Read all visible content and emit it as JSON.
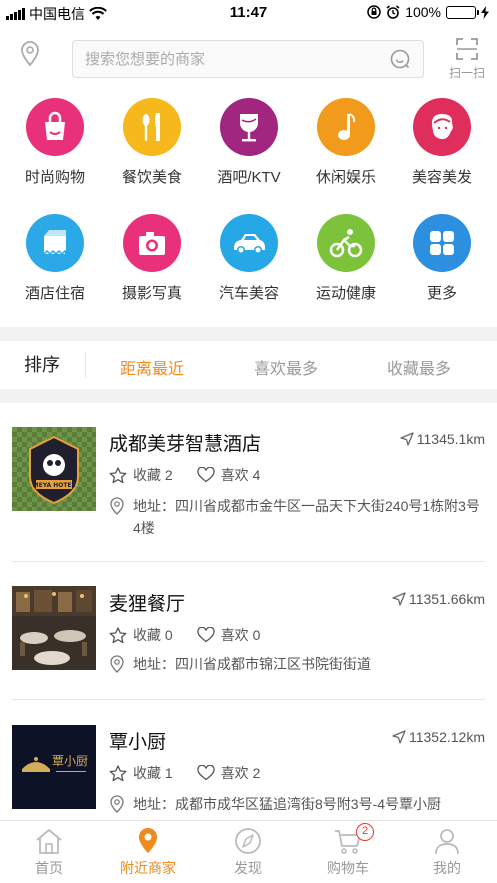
{
  "status_bar": {
    "carrier": "中国电信",
    "time": "11:47",
    "battery": "100%"
  },
  "search": {
    "placeholder": "搜索您想要的商家",
    "scan_label": "扫一扫"
  },
  "categories": [
    {
      "label": "时尚购物",
      "icon": "shopping-bag-icon",
      "color": "#e8317a"
    },
    {
      "label": "餐饮美食",
      "icon": "fork-knife-icon",
      "color": "#f7b81c"
    },
    {
      "label": "酒吧/KTV",
      "icon": "wine-glass-icon",
      "color": "#a0267f"
    },
    {
      "label": "休闲娱乐",
      "icon": "music-note-icon",
      "color": "#f29a1c"
    },
    {
      "label": "美容美发",
      "icon": "beauty-face-icon",
      "color": "#e02e5c"
    },
    {
      "label": "酒店住宿",
      "icon": "hotel-bed-icon",
      "color": "#2aa9e6"
    },
    {
      "label": "摄影写真",
      "icon": "camera-icon",
      "color": "#e8317a"
    },
    {
      "label": "汽车美容",
      "icon": "car-icon",
      "color": "#27a8e6"
    },
    {
      "label": "运动健康",
      "icon": "cycling-icon",
      "color": "#7cc23a"
    },
    {
      "label": "更多",
      "icon": "grid-more-icon",
      "color": "#2d8fe0"
    }
  ],
  "sort": {
    "title": "排序",
    "tabs": [
      "距离最近",
      "喜欢最多",
      "收藏最多"
    ],
    "active_index": 0
  },
  "merchants": [
    {
      "name": "成都美芽智慧酒店",
      "distance": "11345.1km",
      "favorites_label": "收藏 2",
      "likes_label": "喜欢 4",
      "address": "地址：四川省成都市金牛区一品天下大街240号1栋附3号4楼",
      "logo_text": "MEYA HOTEL"
    },
    {
      "name": "麦狸餐厅",
      "distance": "11351.66km",
      "favorites_label": "收藏 0",
      "likes_label": "喜欢 0",
      "address": "地址：四川省成都市锦江区书院街街道"
    },
    {
      "name": "覃小厨",
      "distance": "11352.12km",
      "favorites_label": "收藏 1",
      "likes_label": "喜欢 2",
      "address": "地址：成都市成华区猛追湾街8号附3号-4号覃小厨",
      "logo_text": "覃小厨"
    }
  ],
  "tabbar": {
    "items": [
      "首页",
      "附近商家",
      "发现",
      "购物车",
      "我的"
    ],
    "active_index": 1,
    "cart_badge": "2"
  },
  "colors": {
    "accent": "#f08a1c",
    "text_gray": "#999999"
  }
}
